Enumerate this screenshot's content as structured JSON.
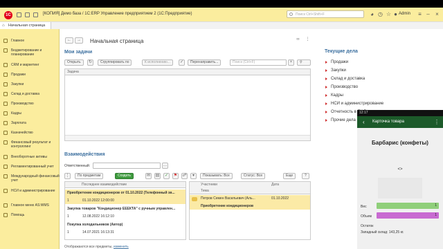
{
  "titlebar": {
    "logo": "1С",
    "title": "[КОПИЯ] Демо база / 1С:ERP Управление предприятием 2  (1С:Предприятие)",
    "search_placeholder": "Поиск Ctrl+Shift+F",
    "user": "Admin",
    "bell_icon": "bell-icon",
    "history_icon": "history-icon",
    "star_icon": "star-icon",
    "settings_icon": "settings-icon"
  },
  "tabs": {
    "home": "Начальная страница"
  },
  "sidebar": {
    "items": [
      {
        "label": "Главное",
        "icon": "menu-icon"
      },
      {
        "label": "Бюджетирование и планирование",
        "icon": "budget-icon"
      },
      {
        "label": "CRM и маркетинг",
        "icon": "crm-icon"
      },
      {
        "label": "Продажи",
        "icon": "sales-icon"
      },
      {
        "label": "Закупки",
        "icon": "purchases-icon"
      },
      {
        "label": "Склад и доставка",
        "icon": "warehouse-icon"
      },
      {
        "label": "Производство",
        "icon": "production-icon"
      },
      {
        "label": "Кадры",
        "icon": "staff-icon"
      },
      {
        "label": "Зарплата",
        "icon": "salary-icon"
      },
      {
        "label": "Казначейство",
        "icon": "treasury-icon"
      },
      {
        "label": "Финансовый результат и контроллинг",
        "icon": "finance-icon"
      },
      {
        "label": "Внеоборотные активы",
        "icon": "assets-icon"
      },
      {
        "label": "Регламентированный учет",
        "icon": "accounting-icon"
      },
      {
        "label": "Международный финансовый учет",
        "icon": "international-icon"
      },
      {
        "label": "НСИ и администрирование",
        "icon": "admin-icon"
      },
      {
        "label": "Главное меню AS:WMS",
        "icon": "wms-icon"
      },
      {
        "label": "Помощь",
        "icon": "help-icon"
      }
    ]
  },
  "main": {
    "page_title": "Начальная страница",
    "tasks": {
      "title": "Мои задачи",
      "open": "Открыть",
      "group_by": "Сгруппировать по",
      "to_execution": "К исполнению...",
      "redirect": "Перенаправить...",
      "search_placeholder": "Поиск (Ctrl+F)",
      "column": "Задача"
    },
    "interactions": {
      "title": "Взаимодействия",
      "responsible_label": "Ответственный:",
      "by_subjects": "По предметам",
      "create": "Создать",
      "show": "Показывать: Все",
      "status": "Статус: Все",
      "more": "Еще",
      "help": "?",
      "left_column": "Последнее взаимодействие",
      "rows": [
        {
          "title": "Приобретение кондиционеров от 01.10.2022 (Телефонный зв...",
          "num": "1",
          "date": "01.10.2022 12:00:00"
        },
        {
          "title": "Закупка товаров \"Кондиционер ЕЕЕКТА\" с ручным управлен...",
          "num": "1",
          "date": "12.08.2022 16:12:10"
        },
        {
          "title": "Покупка холодильников (Автор)",
          "num": "1",
          "date": "14.07.2021 16:13:31"
        }
      ],
      "right_columns": {
        "participants": "Участники",
        "date": "Дата",
        "subject": "Тема"
      },
      "right_rows": [
        {
          "participant": "Петров Семен Васильевич (Аль...",
          "date": "01.10.2022",
          "subject": "Приобретение кондиционеров"
        }
      ],
      "footer_text": "Отображаются все предметы,",
      "footer_link": "изменить"
    }
  },
  "current": {
    "title": "Текущие дела",
    "items": [
      "Продажи",
      "Закупки",
      "Склад и доставка",
      "Производство",
      "Кадры",
      "НСИ и администрирование",
      "Отчетность в ПФР",
      "Прочие дела"
    ]
  },
  "phone": {
    "time": "12:17",
    "header": "Карточка товара",
    "product": "Барбарис (конфеты)",
    "code": "<>",
    "weight_label": "Вес",
    "weight_value": "1",
    "volume_label": "Объем",
    "volume_value": "1",
    "remaining_label": "Остаток",
    "remaining_text": "Западный склад: 143,25 кг.",
    "colors": {
      "weight_bar": "#8fcf7a",
      "volume_bar": "#c86ad1",
      "header": "#1c5a2a"
    }
  },
  "colors": {
    "sidebar": "#fbed9e",
    "section_title": "#3a6e9e",
    "highlight": "#fbeaa6",
    "accent_red": "#d03030"
  }
}
